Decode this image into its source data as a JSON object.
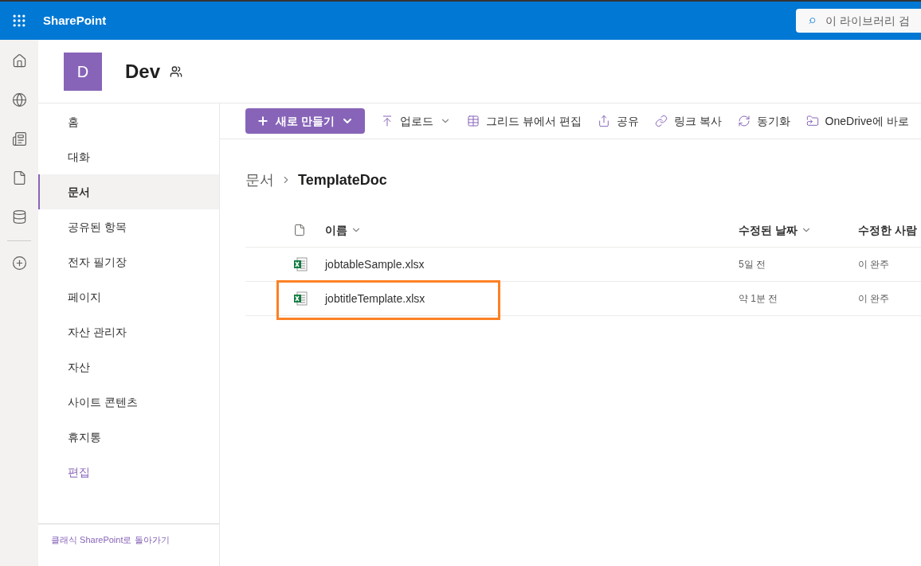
{
  "top_bar": {
    "app_name": "SharePoint",
    "search": {
      "placeholder": "이 라이브러리 검"
    }
  },
  "site": {
    "logo_letter": "D",
    "title": "Dev"
  },
  "nav": {
    "items": [
      {
        "label": "홈",
        "selected": false,
        "kind": "item"
      },
      {
        "label": "대화",
        "selected": false,
        "kind": "item"
      },
      {
        "label": "문서",
        "selected": true,
        "kind": "item"
      },
      {
        "label": "공유된 항목",
        "selected": false,
        "kind": "item"
      },
      {
        "label": "전자 필기장",
        "selected": false,
        "kind": "item"
      },
      {
        "label": "페이지",
        "selected": false,
        "kind": "item"
      },
      {
        "label": "자산 관리자",
        "selected": false,
        "kind": "item"
      },
      {
        "label": "자산",
        "selected": false,
        "kind": "item"
      },
      {
        "label": "사이트 콘텐츠",
        "selected": false,
        "kind": "item"
      },
      {
        "label": "휴지통",
        "selected": false,
        "kind": "item"
      },
      {
        "label": "편집",
        "selected": false,
        "kind": "link"
      }
    ],
    "footer_link": "클래식 SharePoint로 돌아가기"
  },
  "toolbar": {
    "new_button": "새로 만들기",
    "items": [
      {
        "label": "업로드",
        "dropdown": true
      },
      {
        "label": "그리드 뷰에서 편집",
        "dropdown": false
      },
      {
        "label": "공유",
        "dropdown": false
      },
      {
        "label": "링크 복사",
        "dropdown": false
      },
      {
        "label": "동기화",
        "dropdown": false
      },
      {
        "label": "OneDrive에 바로",
        "dropdown": false
      }
    ]
  },
  "breadcrumb": [
    "문서",
    "TemplateDoc"
  ],
  "table": {
    "columns": [
      {
        "label": "이름",
        "sortable": true
      },
      {
        "label": "수정된 날짜",
        "sortable": true
      },
      {
        "label": "수정한 사람",
        "sortable": false
      }
    ],
    "rows": [
      {
        "name": "jobtableSample.xlsx",
        "modified": "5일 전",
        "modified_by": "이 완주",
        "highlighted": false
      },
      {
        "name": "jobtitleTemplate.xlsx",
        "modified": "약 1분 전",
        "modified_by": "이 완주",
        "highlighted": true
      }
    ]
  }
}
